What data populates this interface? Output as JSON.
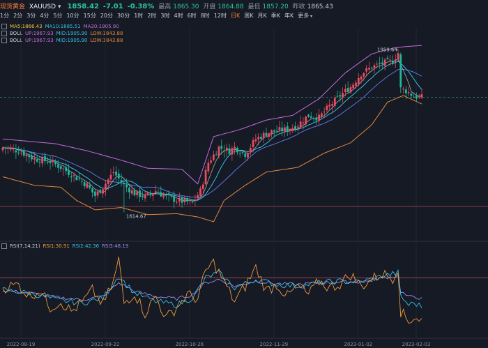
{
  "header": {
    "name": "现货黄金",
    "symbol": "XAUUSD",
    "price": "1858.42",
    "change": "-7.01",
    "change_pct": "-0.38%",
    "high_label": "最高",
    "high": "1865.30",
    "open_label": "开盘",
    "open": "1864.88",
    "low_label": "最低",
    "low": "1857.20",
    "prev_label": "昨收",
    "prev": "1865.43"
  },
  "timeframes": [
    "1分",
    "2分",
    "3分",
    "4分",
    "5分",
    "10分",
    "15分",
    "20分",
    "30分",
    "1时",
    "2时",
    "3时",
    "4时",
    "6时",
    "8时",
    "12时",
    "日K",
    "周K",
    "月K",
    "季K",
    "年K",
    "更多"
  ],
  "active_timeframe": "日K",
  "legend": {
    "ma": {
      "ma5": "MA5:1866.43",
      "ma10": "MA10:1885.51",
      "ma20": "MA20:1905.90"
    },
    "boll1": {
      "label": "BOLL",
      "up": "UP:1967.93",
      "mid": "MID:1905.90",
      "low": "LOW:1843.88"
    },
    "boll2": {
      "label": "BOLL",
      "up": "UP:1967.93",
      "mid": "MID:1905.90",
      "low": "LOW:1843.88"
    },
    "rsi": {
      "label": "RSI(7,14,21)",
      "rsi1": "RSI1:30.91",
      "rsi2": "RSI2:42.36",
      "rsi3": "RSI3:48.19"
    }
  },
  "colors": {
    "up": "#e84b62",
    "down": "#22b59a",
    "ma5": "#f5c342",
    "ma10": "#36c0e5",
    "ma20": "#c66ce0",
    "boll_up": "#c66ce0",
    "boll_mid": "#36c0e5",
    "boll_low": "#e58a3c",
    "rsi1": "#f09a3c",
    "rsi2": "#36c0e5",
    "rsi3": "#9b8cf0"
  },
  "chart_data": {
    "type": "candlestick",
    "x_ticks": [
      "2022-08-19",
      "2022-09-22",
      "2022-10-26",
      "2022-11-29",
      "2023-01-02",
      "2023-02-03"
    ],
    "annotations": {
      "max": "1959.64",
      "min": "1614.67"
    },
    "anchors": {
      "price": [
        [
          0,
          1752
        ],
        [
          6,
          1745
        ],
        [
          12,
          1728
        ],
        [
          18,
          1722
        ],
        [
          22,
          1710
        ],
        [
          28,
          1688
        ],
        [
          32,
          1672
        ],
        [
          35,
          1650
        ],
        [
          38,
          1668
        ],
        [
          42,
          1700
        ],
        [
          46,
          1672
        ],
        [
          50,
          1655
        ],
        [
          54,
          1648
        ],
        [
          58,
          1660
        ],
        [
          62,
          1648
        ],
        [
          66,
          1640
        ],
        [
          72,
          1635
        ],
        [
          75,
          1660
        ],
        [
          78,
          1720
        ],
        [
          82,
          1752
        ],
        [
          86,
          1745
        ],
        [
          88,
          1752
        ],
        [
          92,
          1738
        ],
        [
          96,
          1770
        ],
        [
          100,
          1782
        ],
        [
          104,
          1788
        ],
        [
          108,
          1790
        ],
        [
          112,
          1800
        ],
        [
          116,
          1820
        ],
        [
          120,
          1815
        ],
        [
          124,
          1840
        ],
        [
          128,
          1862
        ],
        [
          132,
          1880
        ],
        [
          136,
          1908
        ],
        [
          140,
          1922
        ],
        [
          144,
          1930
        ],
        [
          148,
          1935
        ],
        [
          150,
          1952
        ],
        [
          151,
          1876
        ],
        [
          153,
          1872
        ],
        [
          156,
          1860
        ],
        [
          159,
          1858
        ]
      ],
      "boll_up": [
        [
          0,
          1770
        ],
        [
          20,
          1760
        ],
        [
          32,
          1745
        ],
        [
          45,
          1725
        ],
        [
          55,
          1708
        ],
        [
          68,
          1706
        ],
        [
          74,
          1675
        ],
        [
          80,
          1775
        ],
        [
          90,
          1790
        ],
        [
          100,
          1810
        ],
        [
          110,
          1820
        ],
        [
          120,
          1855
        ],
        [
          130,
          1910
        ],
        [
          140,
          1950
        ],
        [
          148,
          1962
        ],
        [
          152,
          1965
        ],
        [
          159,
          1968
        ]
      ],
      "boll_low": [
        [
          0,
          1690
        ],
        [
          12,
          1672
        ],
        [
          22,
          1668
        ],
        [
          28,
          1640
        ],
        [
          35,
          1620
        ],
        [
          45,
          1625
        ],
        [
          55,
          1610
        ],
        [
          66,
          1612
        ],
        [
          74,
          1605
        ],
        [
          80,
          1595
        ],
        [
          84,
          1640
        ],
        [
          92,
          1672
        ],
        [
          100,
          1700
        ],
        [
          112,
          1710
        ],
        [
          122,
          1740
        ],
        [
          132,
          1762
        ],
        [
          140,
          1800
        ],
        [
          146,
          1848
        ],
        [
          152,
          1862
        ],
        [
          159,
          1844
        ]
      ],
      "rsi1": [
        [
          0,
          58
        ],
        [
          6,
          62
        ],
        [
          10,
          48
        ],
        [
          14,
          56
        ],
        [
          18,
          35
        ],
        [
          22,
          42
        ],
        [
          26,
          30
        ],
        [
          30,
          40
        ],
        [
          34,
          55
        ],
        [
          38,
          38
        ],
        [
          42,
          65
        ],
        [
          44,
          92
        ],
        [
          46,
          40
        ],
        [
          50,
          52
        ],
        [
          54,
          28
        ],
        [
          58,
          48
        ],
        [
          62,
          22
        ],
        [
          66,
          35
        ],
        [
          70,
          50
        ],
        [
          74,
          45
        ],
        [
          77,
          78
        ],
        [
          80,
          88
        ],
        [
          84,
          65
        ],
        [
          88,
          42
        ],
        [
          92,
          60
        ],
        [
          96,
          82
        ],
        [
          100,
          55
        ],
        [
          104,
          62
        ],
        [
          108,
          48
        ],
        [
          112,
          60
        ],
        [
          116,
          50
        ],
        [
          120,
          66
        ],
        [
          124,
          58
        ],
        [
          128,
          63
        ],
        [
          132,
          74
        ],
        [
          136,
          60
        ],
        [
          140,
          68
        ],
        [
          144,
          75
        ],
        [
          148,
          70
        ],
        [
          150,
          82
        ],
        [
          151,
          30
        ],
        [
          154,
          18
        ],
        [
          156,
          24
        ],
        [
          159,
          20
        ]
      ],
      "rsi2": [
        [
          0,
          56
        ],
        [
          10,
          52
        ],
        [
          20,
          44
        ],
        [
          30,
          40
        ],
        [
          38,
          46
        ],
        [
          44,
          72
        ],
        [
          50,
          52
        ],
        [
          58,
          42
        ],
        [
          66,
          38
        ],
        [
          72,
          46
        ],
        [
          77,
          70
        ],
        [
          82,
          76
        ],
        [
          88,
          58
        ],
        [
          96,
          68
        ],
        [
          104,
          62
        ],
        [
          112,
          60
        ],
        [
          120,
          64
        ],
        [
          128,
          66
        ],
        [
          136,
          65
        ],
        [
          144,
          72
        ],
        [
          150,
          76
        ],
        [
          151,
          48
        ],
        [
          154,
          38
        ],
        [
          156,
          40
        ],
        [
          159,
          36
        ]
      ],
      "rsi3": [
        [
          0,
          55
        ],
        [
          10,
          52
        ],
        [
          20,
          47
        ],
        [
          30,
          44
        ],
        [
          38,
          48
        ],
        [
          44,
          64
        ],
        [
          50,
          54
        ],
        [
          58,
          48
        ],
        [
          66,
          45
        ],
        [
          72,
          50
        ],
        [
          77,
          64
        ],
        [
          82,
          68
        ],
        [
          88,
          60
        ],
        [
          96,
          66
        ],
        [
          104,
          63
        ],
        [
          112,
          62
        ],
        [
          120,
          64
        ],
        [
          128,
          65
        ],
        [
          136,
          65
        ],
        [
          144,
          70
        ],
        [
          150,
          72
        ],
        [
          151,
          54
        ],
        [
          154,
          47
        ],
        [
          156,
          48
        ],
        [
          159,
          45
        ]
      ]
    }
  }
}
